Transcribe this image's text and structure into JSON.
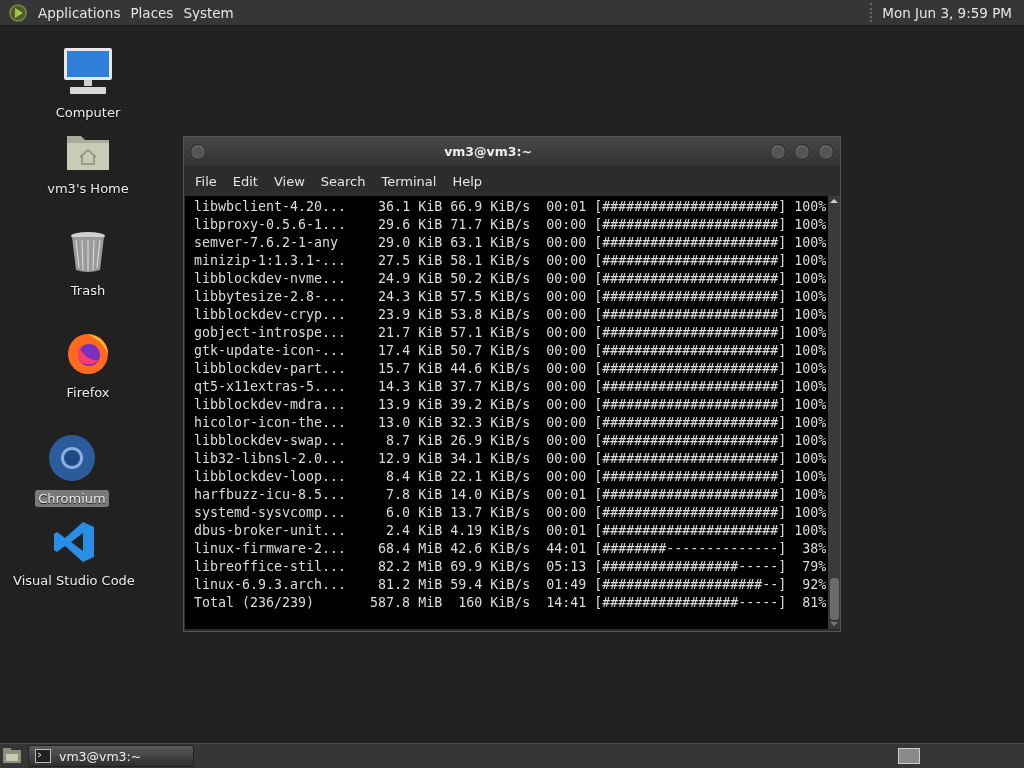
{
  "top_panel": {
    "menus": [
      "Applications",
      "Places",
      "System"
    ],
    "clock": "Mon Jun 3,  9:59 PM"
  },
  "desktop_icons": [
    {
      "kind": "computer",
      "label": "Computer",
      "selected": false
    },
    {
      "kind": "home",
      "label": "vm3's Home",
      "selected": false
    },
    {
      "kind": "trash",
      "label": "Trash",
      "selected": false
    },
    {
      "kind": "firefox",
      "label": "Firefox",
      "selected": false
    },
    {
      "kind": "chromium",
      "label": "Chromium",
      "selected": true
    },
    {
      "kind": "vscode",
      "label": "Visual Studio Code",
      "selected": false
    }
  ],
  "window": {
    "title": "vm3@vm3:~",
    "menu": [
      "File",
      "Edit",
      "View",
      "Search",
      "Terminal",
      "Help"
    ],
    "rows": [
      {
        "name": "libwbclient-4.20...",
        "size": "36.1 KiB",
        "speed": "66.9 KiB/s",
        "eta": "00:01",
        "bar": "[######################]",
        "percent": "100%"
      },
      {
        "name": "libproxy-0.5.6-1...",
        "size": "29.6 KiB",
        "speed": "71.7 KiB/s",
        "eta": "00:00",
        "bar": "[######################]",
        "percent": "100%"
      },
      {
        "name": "semver-7.6.2-1-any",
        "size": "29.0 KiB",
        "speed": "63.1 KiB/s",
        "eta": "00:00",
        "bar": "[######################]",
        "percent": "100%"
      },
      {
        "name": "minizip-1:1.3.1-...",
        "size": "27.5 KiB",
        "speed": "58.1 KiB/s",
        "eta": "00:00",
        "bar": "[######################]",
        "percent": "100%"
      },
      {
        "name": "libblockdev-nvme...",
        "size": "24.9 KiB",
        "speed": "50.2 KiB/s",
        "eta": "00:00",
        "bar": "[######################]",
        "percent": "100%"
      },
      {
        "name": "libbytesize-2.8-...",
        "size": "24.3 KiB",
        "speed": "57.5 KiB/s",
        "eta": "00:00",
        "bar": "[######################]",
        "percent": "100%"
      },
      {
        "name": "libblockdev-cryp...",
        "size": "23.9 KiB",
        "speed": "53.8 KiB/s",
        "eta": "00:00",
        "bar": "[######################]",
        "percent": "100%"
      },
      {
        "name": "gobject-introspe...",
        "size": "21.7 KiB",
        "speed": "57.1 KiB/s",
        "eta": "00:00",
        "bar": "[######################]",
        "percent": "100%"
      },
      {
        "name": "gtk-update-icon-...",
        "size": "17.4 KiB",
        "speed": "50.7 KiB/s",
        "eta": "00:00",
        "bar": "[######################]",
        "percent": "100%"
      },
      {
        "name": "libblockdev-part...",
        "size": "15.7 KiB",
        "speed": "44.6 KiB/s",
        "eta": "00:00",
        "bar": "[######################]",
        "percent": "100%"
      },
      {
        "name": "qt5-x11extras-5....",
        "size": "14.3 KiB",
        "speed": "37.7 KiB/s",
        "eta": "00:00",
        "bar": "[######################]",
        "percent": "100%"
      },
      {
        "name": "libblockdev-mdra...",
        "size": "13.9 KiB",
        "speed": "39.2 KiB/s",
        "eta": "00:00",
        "bar": "[######################]",
        "percent": "100%"
      },
      {
        "name": "hicolor-icon-the...",
        "size": "13.0 KiB",
        "speed": "32.3 KiB/s",
        "eta": "00:00",
        "bar": "[######################]",
        "percent": "100%"
      },
      {
        "name": "libblockdev-swap...",
        "size": "8.7 KiB",
        "speed": "26.9 KiB/s",
        "eta": "00:00",
        "bar": "[######################]",
        "percent": "100%"
      },
      {
        "name": "lib32-libnsl-2.0...",
        "size": "12.9 KiB",
        "speed": "34.1 KiB/s",
        "eta": "00:00",
        "bar": "[######################]",
        "percent": "100%"
      },
      {
        "name": "libblockdev-loop...",
        "size": "8.4 KiB",
        "speed": "22.1 KiB/s",
        "eta": "00:00",
        "bar": "[######################]",
        "percent": "100%"
      },
      {
        "name": "harfbuzz-icu-8.5...",
        "size": "7.8 KiB",
        "speed": "14.0 KiB/s",
        "eta": "00:01",
        "bar": "[######################]",
        "percent": "100%"
      },
      {
        "name": "systemd-sysvcomp...",
        "size": "6.0 KiB",
        "speed": "13.7 KiB/s",
        "eta": "00:00",
        "bar": "[######################]",
        "percent": "100%"
      },
      {
        "name": "dbus-broker-unit...",
        "size": "2.4 KiB",
        "speed": "4.19 KiB/s",
        "eta": "00:01",
        "bar": "[######################]",
        "percent": "100%"
      },
      {
        "name": "linux-firmware-2...",
        "size": "68.4 MiB",
        "speed": "42.6 KiB/s",
        "eta": "44:01",
        "bar": "[########--------------]",
        "percent": "38%"
      },
      {
        "name": "libreoffice-stil...",
        "size": "82.2 MiB",
        "speed": "69.9 KiB/s",
        "eta": "05:13",
        "bar": "[#################-----]",
        "percent": "79%"
      },
      {
        "name": "linux-6.9.3.arch...",
        "size": "81.2 MiB",
        "speed": "59.4 KiB/s",
        "eta": "01:49",
        "bar": "[####################--]",
        "percent": "92%"
      },
      {
        "name": "Total (236/239)",
        "size": "587.8 MiB",
        "speed": "160 KiB/s",
        "eta": "14:41",
        "bar": "[#################-----]",
        "percent": "81%"
      }
    ]
  },
  "taskbar": {
    "tasks": [
      {
        "label": "vm3@vm3:~"
      }
    ]
  }
}
